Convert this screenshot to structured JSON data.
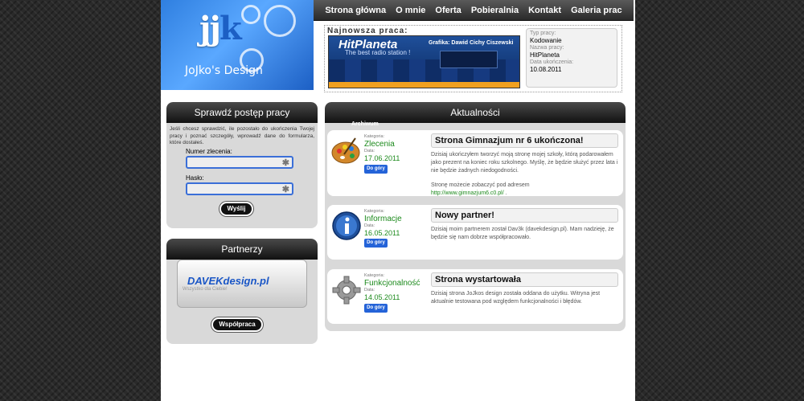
{
  "logo": {
    "brand": "JoJko's Design"
  },
  "nav": [
    "Strona główna",
    "O mnie",
    "Oferta",
    "Pobieralnia",
    "Kontakt",
    "Galeria prac"
  ],
  "newest": {
    "title": "Najnowsza praca:",
    "thumb_logo": "HitPlaneta",
    "thumb_slogan": "The best radio station !",
    "thumb_credit": "Grafika: Dawid Cichy Ciszewski",
    "info": {
      "type_label": "Typ pracy:",
      "type_value": "Kodowanie",
      "name_label": "Nazwa pracy:",
      "name_value": "HitPlaneta",
      "date_label": "Data ukończenia:",
      "date_value": "10.08.2011"
    }
  },
  "progress": {
    "title": "Sprawdź postęp pracy",
    "description": "Jeśli chcesz sprawdzić, ile pozostało do ukończenia Twojej pracy i poznać szczegóły, wprowadź dane do formularza, które dostałeś.",
    "order_label": "Numer zlecenia:",
    "password_label": "Hasło:",
    "submit": "Wyślij"
  },
  "partners": {
    "title": "Partnerzy",
    "partner_name": "DAVEKdesign.pl",
    "partner_slogan": "Wszystko dla Ciebie!",
    "button": "Współpraca"
  },
  "news": {
    "title": "Aktualności",
    "archive": "Archiwum",
    "category_label": "Kategoria:",
    "date_label": "Data:",
    "top_button": "Do góry",
    "items": [
      {
        "category": "Zlecenia",
        "date": "17.06.2011",
        "title": "Strona Gimnazjum nr 6 ukończona!",
        "text": "Dzisiaj ukończyłem tworzyć moją stronę mojej szkoły, którą podarowałem jako prezent na koniec roku szkolnego. Myślę, że będzie służyć przez lata i nie będzie żadnych niedogodności.",
        "text2": "Stronę możecie zobaczyć pod adresem",
        "link": "http://www.gimnazjum6.c0.pl/",
        "icon": "palette-icon"
      },
      {
        "category": "Informacje",
        "date": "16.05.2011",
        "title": "Nowy partner!",
        "text": "Dzisiaj moim partnerem został Dav3k (davekdesign.pl). Mam nadzieję, że będzie się nam dobrze współpracowało.",
        "icon": "info-icon"
      },
      {
        "category": "Funkcjonalność",
        "date": "14.05.2011",
        "title": "Strona wystartowała",
        "text": "Dzisiaj strona JoJkos design została oddana do użytku. Witryna jest aktualnie testowana pod względem funkcjonalności i błędów.",
        "icon": "gear-icon"
      }
    ]
  },
  "colors": {
    "accent": "#2463d8",
    "green": "#1c8a1c",
    "dark": "#1a1a1a"
  }
}
